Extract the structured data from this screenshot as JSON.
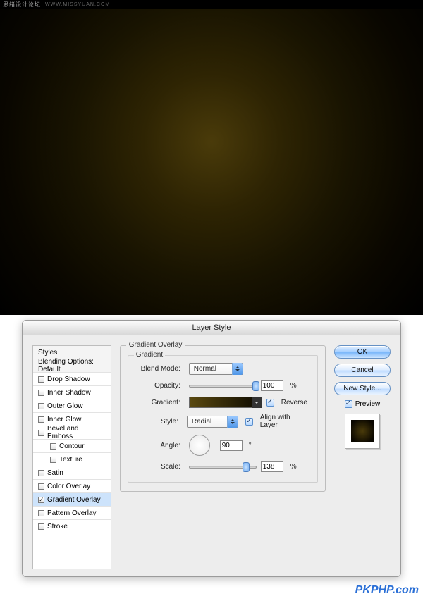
{
  "topbar": {
    "cn": "思绪设计论坛",
    "url": "WWW.MISSYUAN.COM"
  },
  "dialog": {
    "title": "Layer Style",
    "sidebar": {
      "styles_header": "Styles",
      "blending_header": "Blending Options: Default",
      "items": [
        {
          "label": "Drop Shadow",
          "on": false
        },
        {
          "label": "Inner Shadow",
          "on": false
        },
        {
          "label": "Outer Glow",
          "on": false
        },
        {
          "label": "Inner Glow",
          "on": false
        },
        {
          "label": "Bevel and Emboss",
          "on": false
        },
        {
          "label": "Contour",
          "on": false,
          "sub": true
        },
        {
          "label": "Texture",
          "on": false,
          "sub": true
        },
        {
          "label": "Satin",
          "on": false
        },
        {
          "label": "Color Overlay",
          "on": false
        },
        {
          "label": "Gradient Overlay",
          "on": true,
          "selected": true
        },
        {
          "label": "Pattern Overlay",
          "on": false
        },
        {
          "label": "Stroke",
          "on": false
        }
      ]
    },
    "panel": {
      "group_title": "Gradient Overlay",
      "inner_title": "Gradient",
      "blend_mode_label": "Blend Mode:",
      "blend_mode_value": "Normal",
      "opacity_label": "Opacity:",
      "opacity_value": "100",
      "gradient_label": "Gradient:",
      "reverse_label": "Reverse",
      "style_label": "Style:",
      "style_value": "Radial",
      "align_label": "Align with Layer",
      "angle_label": "Angle:",
      "angle_value": "90",
      "angle_unit": "°",
      "scale_label": "Scale:",
      "scale_value": "138",
      "pct": "%"
    },
    "buttons": {
      "ok": "OK",
      "cancel": "Cancel",
      "newstyle": "New Style..."
    },
    "preview_label": "Preview"
  },
  "watermark": "PKPHP.com"
}
